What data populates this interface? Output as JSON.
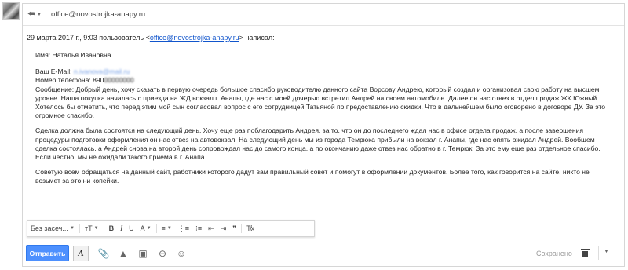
{
  "header": {
    "recipient": "office@novostrojka-anapy.ru"
  },
  "quote_header": {
    "prefix": "29 марта 2017 г., 9:03 пользователь <",
    "email": "office@novostrojka-anapy.ru",
    "suffix": "> написал:"
  },
  "message": {
    "name_line": "Имя: Наталья Ивановна",
    "email_label": "Ваш E-Mail: ",
    "email_value": "n.ivanova@mail.ru",
    "phone_label": "Номер телефона: 890",
    "phone_value": "00000000",
    "p1": "Сообщение: Добрый день, хочу сказать в первую очередь большое спасибо руководителю данного сайта Ворсову Андрею, который создал и организовал свою работу на высшем уровне. Наша покупка началась с приезда на ЖД вокзал г. Анапы, где нас с моей дочерью встретил Андрей на своем автомобиле. Далее он нас отвез в отдел продаж ЖК Южный. Хотелось бы отметить, что перед этим мой сын согласовал вопрос с его сотрудницей Татьяной по предоставлению скидки. Что в дальнейшем было оговорено в договоре ДУ. За это огромное спасибо.",
    "p2": "Сделка должна была состоятся на следующий день. Хочу еще раз поблагодарить Андрея, за то, что он до последнего ждал нас в офисе отдела продаж, а после завершения процедуры подготовки оформления он нас отвез на автовокзал. На следующий день мы из города Темрюка прибыли на вокзал г. Анапы, где нас опять ожидал Андрей. Вообщем сделка состоялась, а Андрей снова на второй день сопровождал нас до самого конца, а по окончанию даже отвез нас обратно в г. Темрюк. За это ему еще раз отдельное спасибо. Если честно, мы не ожидали такого приема в г. Анапа.",
    "p3": "Советую всем обращаться на данный сайт, работники которого дадут вам правильный совет и помогут в оформлении документов. Более того, как говорится на сайте, никто не возьмет за это ни копейки."
  },
  "format_toolbar": {
    "font_label": "Без засеч...",
    "size_label": "тT",
    "bold": "B",
    "italic": "I",
    "underline": "U",
    "text_color": "A",
    "align": "≡",
    "numbered_list": "⋮≡",
    "bullet_list": "⁝≡",
    "indent_less": "⇤",
    "indent_more": "⇥",
    "quote": "❞",
    "clear_format": "T̸x"
  },
  "bottom_toolbar": {
    "send_label": "Отправить",
    "format_toggle": "A",
    "attach_icon": "📎",
    "drive_icon": "▲",
    "photo_icon": "▣",
    "link_icon": "⊖",
    "emoji_icon": "☺",
    "saved_label": "Сохранено",
    "more_caret": "▼"
  },
  "colors": {
    "send_button": "#4d90fe",
    "link": "#1155cc"
  }
}
